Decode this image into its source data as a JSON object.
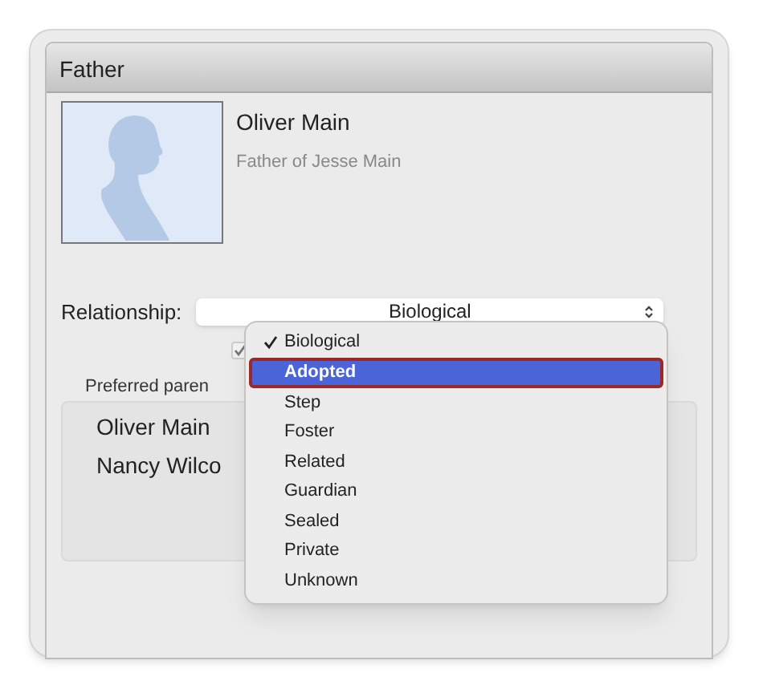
{
  "panel": {
    "title": "Father"
  },
  "person": {
    "name": "Oliver Main",
    "subtitle": "Father of Jesse Main"
  },
  "relationship": {
    "label": "Relationship:",
    "value": "Biological"
  },
  "checkbox": {
    "checked": true,
    "disabled": true
  },
  "preferred_parents": {
    "label": "Preferred paren",
    "items": [
      "Oliver Main",
      "Nancy Wilco"
    ]
  },
  "menu": [
    {
      "label": "Biological",
      "checked": true,
      "selected": false
    },
    {
      "label": "Adopted",
      "checked": false,
      "selected": true
    },
    {
      "label": "Step",
      "checked": false,
      "selected": false
    },
    {
      "label": "Foster",
      "checked": false,
      "selected": false
    },
    {
      "label": "Related",
      "checked": false,
      "selected": false
    },
    {
      "label": "Guardian",
      "checked": false,
      "selected": false
    },
    {
      "label": "Sealed",
      "checked": false,
      "selected": false
    },
    {
      "label": "Private",
      "checked": false,
      "selected": false
    },
    {
      "label": "Unknown",
      "checked": false,
      "selected": false
    }
  ]
}
